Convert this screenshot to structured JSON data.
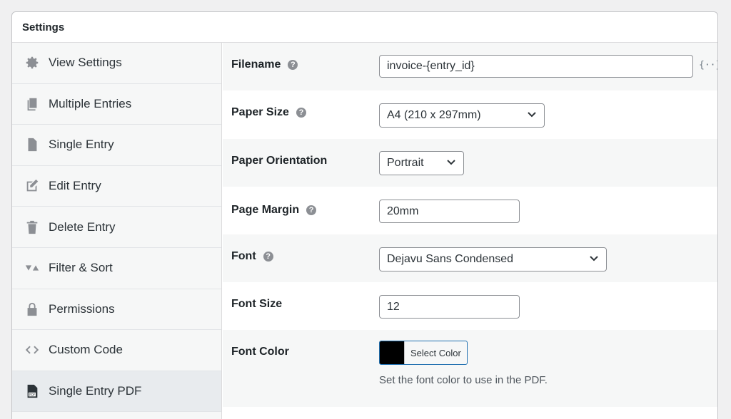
{
  "panel": {
    "title": "Settings"
  },
  "sidebar": {
    "items": [
      {
        "label": "View Settings",
        "icon": "gear-icon"
      },
      {
        "label": "Multiple Entries",
        "icon": "copy-icon"
      },
      {
        "label": "Single Entry",
        "icon": "document-icon"
      },
      {
        "label": "Edit Entry",
        "icon": "edit-icon"
      },
      {
        "label": "Delete Entry",
        "icon": "trash-icon"
      },
      {
        "label": "Filter & Sort",
        "icon": "filter-icon"
      },
      {
        "label": "Permissions",
        "icon": "lock-icon"
      },
      {
        "label": "Custom Code",
        "icon": "code-icon"
      },
      {
        "label": "Single Entry PDF",
        "icon": "pdf-icon",
        "active": true
      }
    ]
  },
  "settings": {
    "filename": {
      "label": "Filename",
      "value": "invoice-{entry_id}",
      "merge_tag": "{··}"
    },
    "paper_size": {
      "label": "Paper Size",
      "value": "A4 (210 x 297mm)"
    },
    "paper_orientation": {
      "label": "Paper Orientation",
      "value": "Portrait"
    },
    "page_margin": {
      "label": "Page Margin",
      "value": "20mm"
    },
    "font": {
      "label": "Font",
      "value": "Dejavu Sans Condensed"
    },
    "font_size": {
      "label": "Font Size",
      "value": "12"
    },
    "font_color": {
      "label": "Font Color",
      "button_label": "Select Color",
      "color": "#000000",
      "description": "Set the font color to use in the PDF."
    }
  },
  "colors": {
    "accent": "#2271b1",
    "background": "#f0f0f1"
  }
}
